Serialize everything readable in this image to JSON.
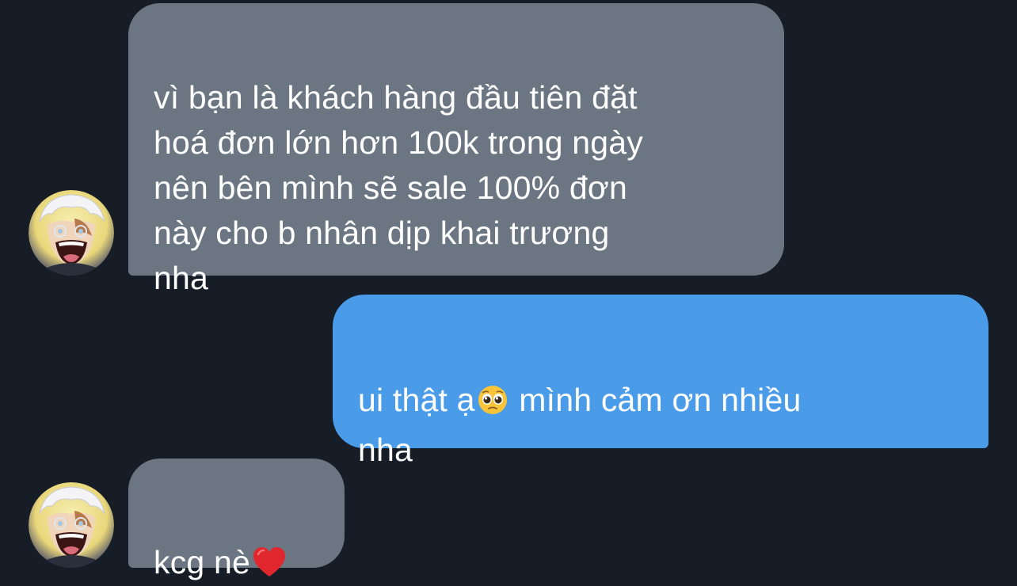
{
  "colors": {
    "background": "#161d27",
    "incoming_bubble": "#6b7682",
    "outgoing_bubble": "#4a9be8",
    "text": "#ffffff"
  },
  "messages": [
    {
      "direction": "incoming",
      "text": "vì bạn là khách hàng đầu tiên đặt\nhoá đơn lớn hơn 100k trong ngày\nnên bên mình sẽ sale 100% đơn\nnày cho b nhân dịp khai trương\nnha",
      "has_avatar": true,
      "avatar_icon": "anime-character-avatar"
    },
    {
      "direction": "outgoing",
      "text_before_emoji": "ui thật ạ",
      "emoji": "pleading-face-emoji",
      "text_after_emoji": "  mình cảm ơn nhiều\nnha",
      "has_avatar": false
    },
    {
      "direction": "incoming",
      "text_before_emoji": "kcg nè",
      "emoji": "red-heart-emoji",
      "has_avatar": true,
      "avatar_icon": "anime-character-avatar"
    }
  ]
}
